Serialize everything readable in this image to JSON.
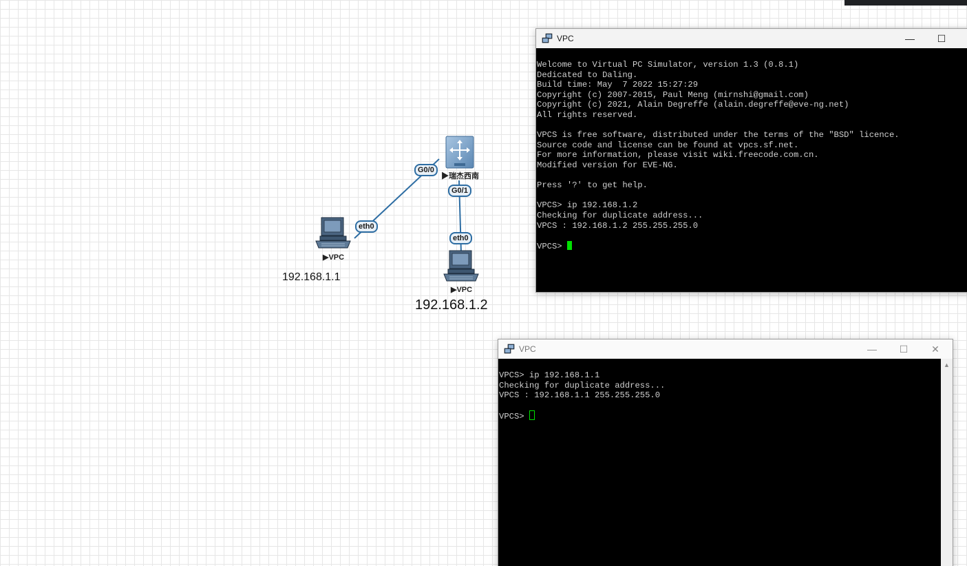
{
  "canvas": {
    "nodes": [
      {
        "id": "vpc1",
        "label": "▶VPC",
        "ip": "192.168.1.1"
      },
      {
        "id": "vpc2",
        "label": "▶VPC",
        "ip": "192.168.1.2"
      },
      {
        "id": "switch",
        "label": "▶瑞杰西南"
      }
    ],
    "links": [
      {
        "from": "vpc1",
        "from_port": "eth0",
        "to": "switch",
        "to_port": "G0/0"
      },
      {
        "from": "switch",
        "from_port": "G0/1",
        "to": "vpc2",
        "to_port": "eth0"
      }
    ],
    "link_color": "#2d6da3"
  },
  "windows": [
    {
      "title": "VPC",
      "minimize": "—",
      "maximize": "☐",
      "lines": [
        "Welcome to Virtual PC Simulator, version 1.3 (0.8.1)",
        "Dedicated to Daling.",
        "Build time: May  7 2022 15:27:29",
        "Copyright (c) 2007-2015, Paul Meng (mirnshi@gmail.com)",
        "Copyright (c) 2021, Alain Degreffe (alain.degreffe@eve-ng.net)",
        "All rights reserved.",
        "",
        "VPCS is free software, distributed under the terms of the \"BSD\" licence.",
        "Source code and license can be found at vpcs.sf.net.",
        "For more information, please visit wiki.freecode.com.cn.",
        "Modified version for EVE-NG.",
        "",
        "Press '?' to get help.",
        "",
        "VPCS> ip 192.168.1.2",
        "Checking for duplicate address...",
        "VPCS : 192.168.1.2 255.255.255.0",
        ""
      ],
      "prompt": "VPCS> "
    },
    {
      "title": "VPC",
      "minimize": "—",
      "maximize": "☐",
      "close": "✕",
      "lines": [
        "VPCS> ip 192.168.1.1",
        "Checking for duplicate address...",
        "VPCS : 192.168.1.1 255.255.255.0",
        ""
      ],
      "prompt": "VPCS> "
    }
  ],
  "icons": {
    "pc": "desktop-computer-icon",
    "switch": "layer3-switch-icon",
    "app": "network-monitors-icon"
  },
  "colors": {
    "cursor": "#00e000",
    "terminal_bg": "#000000",
    "terminal_fg": "#cfcfcf"
  }
}
